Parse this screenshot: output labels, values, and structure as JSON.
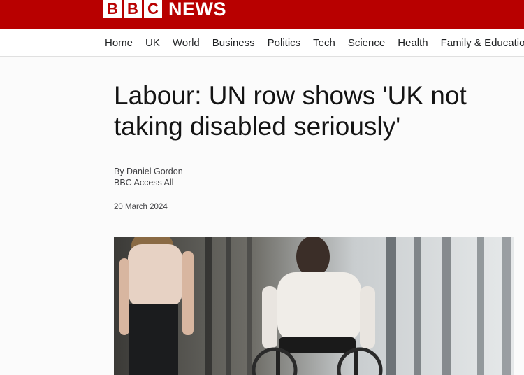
{
  "brand": {
    "logo_letters": [
      "B",
      "B",
      "C"
    ],
    "logo_word": "NEWS",
    "color": "#b80000"
  },
  "nav": {
    "items": [
      "Home",
      "UK",
      "World",
      "Business",
      "Politics",
      "Tech",
      "Science",
      "Health",
      "Family & Education"
    ]
  },
  "article": {
    "headline": "Labour: UN row shows 'UK not taking disabled seriously'",
    "author": "By Daniel Gordon",
    "department": "BBC Access All",
    "date": "20 March 2024"
  },
  "image": {
    "subject": "office-corridor-wheelchair-photo"
  }
}
